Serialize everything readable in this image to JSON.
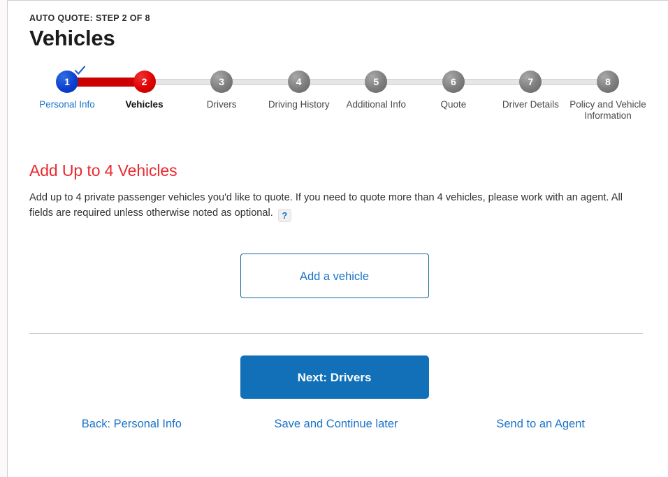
{
  "header": {
    "eyebrow": "AUTO QUOTE: STEP 2 OF 8",
    "title": "Vehicles"
  },
  "stepper": {
    "steps": [
      {
        "number": "1",
        "label": "Personal Info",
        "state": "done"
      },
      {
        "number": "2",
        "label": "Vehicles",
        "state": "current"
      },
      {
        "number": "3",
        "label": "Drivers",
        "state": "todo"
      },
      {
        "number": "4",
        "label": "Driving History",
        "state": "todo"
      },
      {
        "number": "5",
        "label": "Additional Info",
        "state": "todo"
      },
      {
        "number": "6",
        "label": "Quote",
        "state": "todo"
      },
      {
        "number": "7",
        "label": "Driver Details",
        "state": "todo"
      },
      {
        "number": "8",
        "label": "Policy and Vehicle Information",
        "state": "todo"
      }
    ],
    "check_icon": "check-icon"
  },
  "main": {
    "section_heading": "Add Up to 4 Vehicles",
    "section_body": "Add up to 4 private passenger vehicles you'd like to quote. If you need to quote more than 4 vehicles, please work with an agent. All fields are required unless otherwise noted as optional.",
    "help_icon_label": "?",
    "add_vehicle_label": "Add a vehicle"
  },
  "footer": {
    "next_label": "Next: Drivers",
    "links": [
      {
        "label": "Back: Personal Info"
      },
      {
        "label": "Save and Continue later"
      },
      {
        "label": "Send to an Agent"
      }
    ]
  },
  "colors": {
    "brand_red": "#e8292f",
    "step_red": "#cc0000",
    "step_blue": "#0d3fd0",
    "link_blue": "#1a73c8",
    "button_blue": "#1170b8",
    "bar_grey": "#e6e6e6"
  }
}
